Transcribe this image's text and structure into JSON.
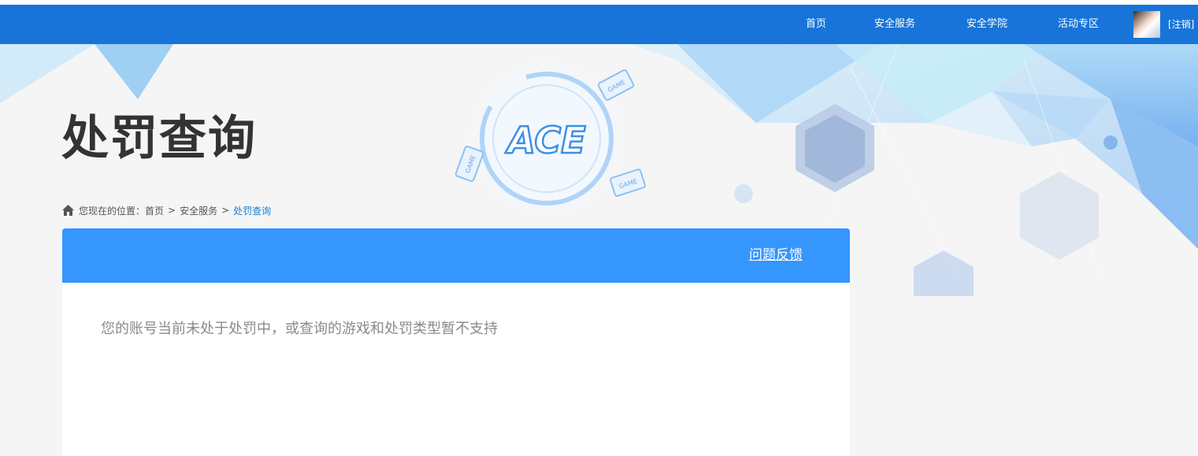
{
  "nav": {
    "items": [
      {
        "label": "首页"
      },
      {
        "label": "安全服务"
      },
      {
        "label": "安全学院"
      },
      {
        "label": "活动专区"
      }
    ],
    "logout_label": "[注销]"
  },
  "banner": {
    "logo_text": "ACE",
    "game_badge": "GAME"
  },
  "page": {
    "title": "处罚查询"
  },
  "breadcrumb": {
    "prefix": "您现在的位置：",
    "items": [
      "首页",
      "安全服务"
    ],
    "current": "处罚查询",
    "separator": ">"
  },
  "panel": {
    "feedback_label": "问题反馈",
    "message": "您的账号当前未处于处罚中，或查询的游戏和处罚类型暂不支持"
  },
  "colors": {
    "navbar": "#1874d8",
    "panel_header": "#3596fe",
    "breadcrumb_current": "#1a7fd4",
    "title": "#333333"
  }
}
